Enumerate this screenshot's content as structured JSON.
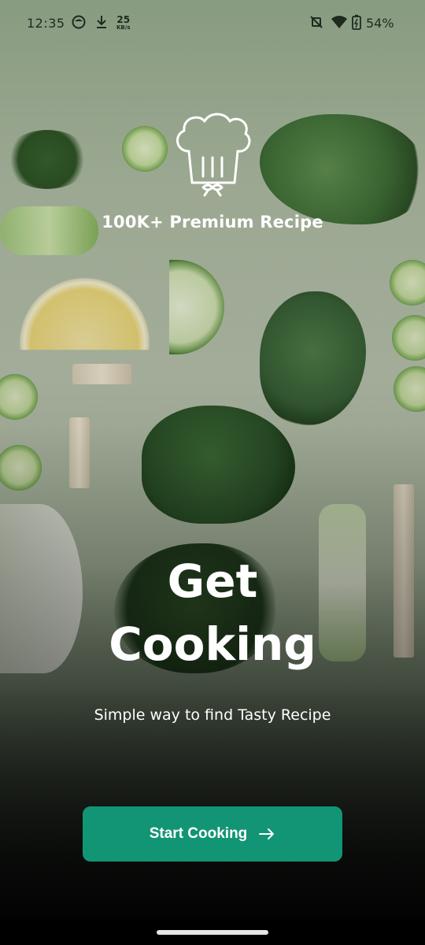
{
  "status_bar": {
    "time": "12:35",
    "speed_value": "25",
    "speed_unit": "KB/s",
    "battery": "54%",
    "icons": [
      "face-icon",
      "download-icon",
      "mute-icon",
      "wifi-icon",
      "battery-icon"
    ]
  },
  "logo": {
    "icon": "chef-hat-icon"
  },
  "tagline": "100K+ Premium Recipe",
  "headline": {
    "line1": "Get",
    "line2": "Cooking"
  },
  "subtitle": "Simple way to find Tasty Recipe",
  "cta": {
    "label": "Start Cooking",
    "icon": "arrow-right-icon",
    "color": "#129575"
  }
}
